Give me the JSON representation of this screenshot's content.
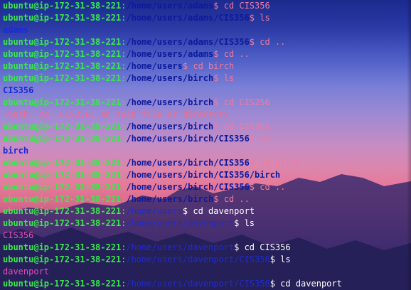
{
  "colors": {
    "user": "#39e84b",
    "path": "#0d1a9c",
    "path_lower": "#1f2bd0",
    "command_upper": "#f07aa0",
    "command_lower": "#ffffff",
    "output_upper": "#1a2ad6",
    "output_lower": "#e94bb7",
    "error": "#ef6a8e"
  },
  "terminal": {
    "lines": [
      {
        "type": "prompt",
        "user": "ubuntu@ip-172-31-38-221",
        "path": "/home/users/adams",
        "sym": "$ ",
        "cmd": "cd CIS356"
      },
      {
        "type": "prompt",
        "user": "ubuntu@ip-172-31-38-221",
        "path": "/home/users/adams/CIS356",
        "sym": "$ ",
        "cmd": "ls"
      },
      {
        "type": "output",
        "text": "adams"
      },
      {
        "type": "prompt",
        "user": "ubuntu@ip-172-31-38-221",
        "path": "/home/users/adams/CIS356",
        "sym": "$ ",
        "cmd": "cd .."
      },
      {
        "type": "prompt",
        "user": "ubuntu@ip-172-31-38-221",
        "path": "/home/users/adams",
        "sym": "$ ",
        "cmd": "cd .."
      },
      {
        "type": "prompt",
        "user": "ubuntu@ip-172-31-38-221",
        "path": "/home/users",
        "sym": "$ ",
        "cmd": "cd birch"
      },
      {
        "type": "prompt",
        "user": "ubuntu@ip-172-31-38-221",
        "path": "/home/users/birch",
        "sym": "$ ",
        "cmd": "ls"
      },
      {
        "type": "output",
        "text": "CIS356"
      },
      {
        "type": "prompt",
        "user": "ubuntu@ip-172-31-38-221",
        "path": "/home/users/birch",
        "sym": "$ ",
        "cmd": "cd CIS256"
      },
      {
        "type": "error",
        "text": "-bash: cd: CIS256: No such file or directory"
      },
      {
        "type": "prompt",
        "user": "ubuntu@ip-172-31-38-221",
        "path": "/home/users/birch",
        "sym": "$ ",
        "cmd": "cd CIS356"
      },
      {
        "type": "prompt",
        "user": "ubuntu@ip-172-31-38-221",
        "path": "/home/users/birch/CIS356",
        "sym": "$ ",
        "cmd": "ls"
      },
      {
        "type": "output",
        "text": "birch"
      },
      {
        "type": "prompt",
        "user": "ubuntu@ip-172-31-38-221",
        "path": "/home/users/birch/CIS356",
        "sym": "$ ",
        "cmd": "cd birch"
      },
      {
        "type": "prompt",
        "user": "ubuntu@ip-172-31-38-221",
        "path": "/home/users/birch/CIS356/birch",
        "sym": "$ ",
        "cmd": "cd .."
      },
      {
        "type": "prompt",
        "user": "ubuntu@ip-172-31-38-221",
        "path": "/home/users/birch/CIS356",
        "sym": "$ ",
        "cmd": "cd .."
      },
      {
        "type": "prompt",
        "user": "ubuntu@ip-172-31-38-221",
        "path": "/home/users/birch",
        "sym": "$ ",
        "cmd": "cd .."
      },
      {
        "type": "prompt",
        "user": "ubuntu@ip-172-31-38-221",
        "path": "/home/users",
        "sym": "$ ",
        "cmd": "cd davenport"
      },
      {
        "type": "prompt",
        "user": "ubuntu@ip-172-31-38-221",
        "path": "/home/users/davenport",
        "sym": "$ ",
        "cmd": "ls"
      },
      {
        "type": "output",
        "text": "CIS356"
      },
      {
        "type": "prompt",
        "user": "ubuntu@ip-172-31-38-221",
        "path": "/home/users/davenport",
        "sym": "$ ",
        "cmd": "cd CIS356"
      },
      {
        "type": "prompt",
        "user": "ubuntu@ip-172-31-38-221",
        "path": "/home/users/davenport/CIS356",
        "sym": "$ ",
        "cmd": "ls"
      },
      {
        "type": "output",
        "text": "davenport"
      },
      {
        "type": "prompt",
        "user": "ubuntu@ip-172-31-38-221",
        "path": "/home/users/davenport/CIS356",
        "sym": "$ ",
        "cmd": "cd davenport"
      }
    ]
  }
}
